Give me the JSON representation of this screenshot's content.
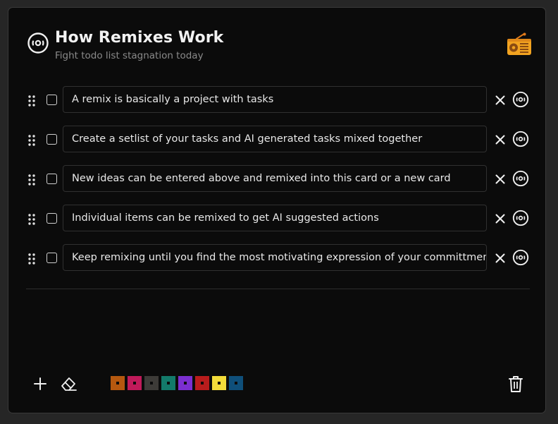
{
  "header": {
    "title": "How Remixes Work",
    "subtitle": "Fight todo list stagnation today",
    "icons": [
      "remix-disc-icon",
      "radio-icon"
    ]
  },
  "tasks": [
    {
      "text": "A remix is basically a project with tasks",
      "checked": false
    },
    {
      "text": "Create a setlist of your tasks and AI generated tasks mixed together",
      "checked": false
    },
    {
      "text": "New ideas can be entered above and remixed into this card or a new card",
      "checked": false
    },
    {
      "text": "Individual items can be remixed to get AI suggested actions",
      "checked": false
    },
    {
      "text": "Keep remixing until you find the most motivating expression of your committment",
      "checked": false
    }
  ],
  "row_icons": [
    "drag-handle-icon",
    "close-icon",
    "remix-disc-icon"
  ],
  "footer": {
    "icons": [
      "plus-icon",
      "eraser-icon",
      "trash-icon"
    ],
    "swatches": [
      "#b5580f",
      "#c01a5a",
      "#3d3b38",
      "#137a6a",
      "#7b2fd0",
      "#b81c1c",
      "#f2dc3a",
      "#0f4f7a"
    ]
  }
}
